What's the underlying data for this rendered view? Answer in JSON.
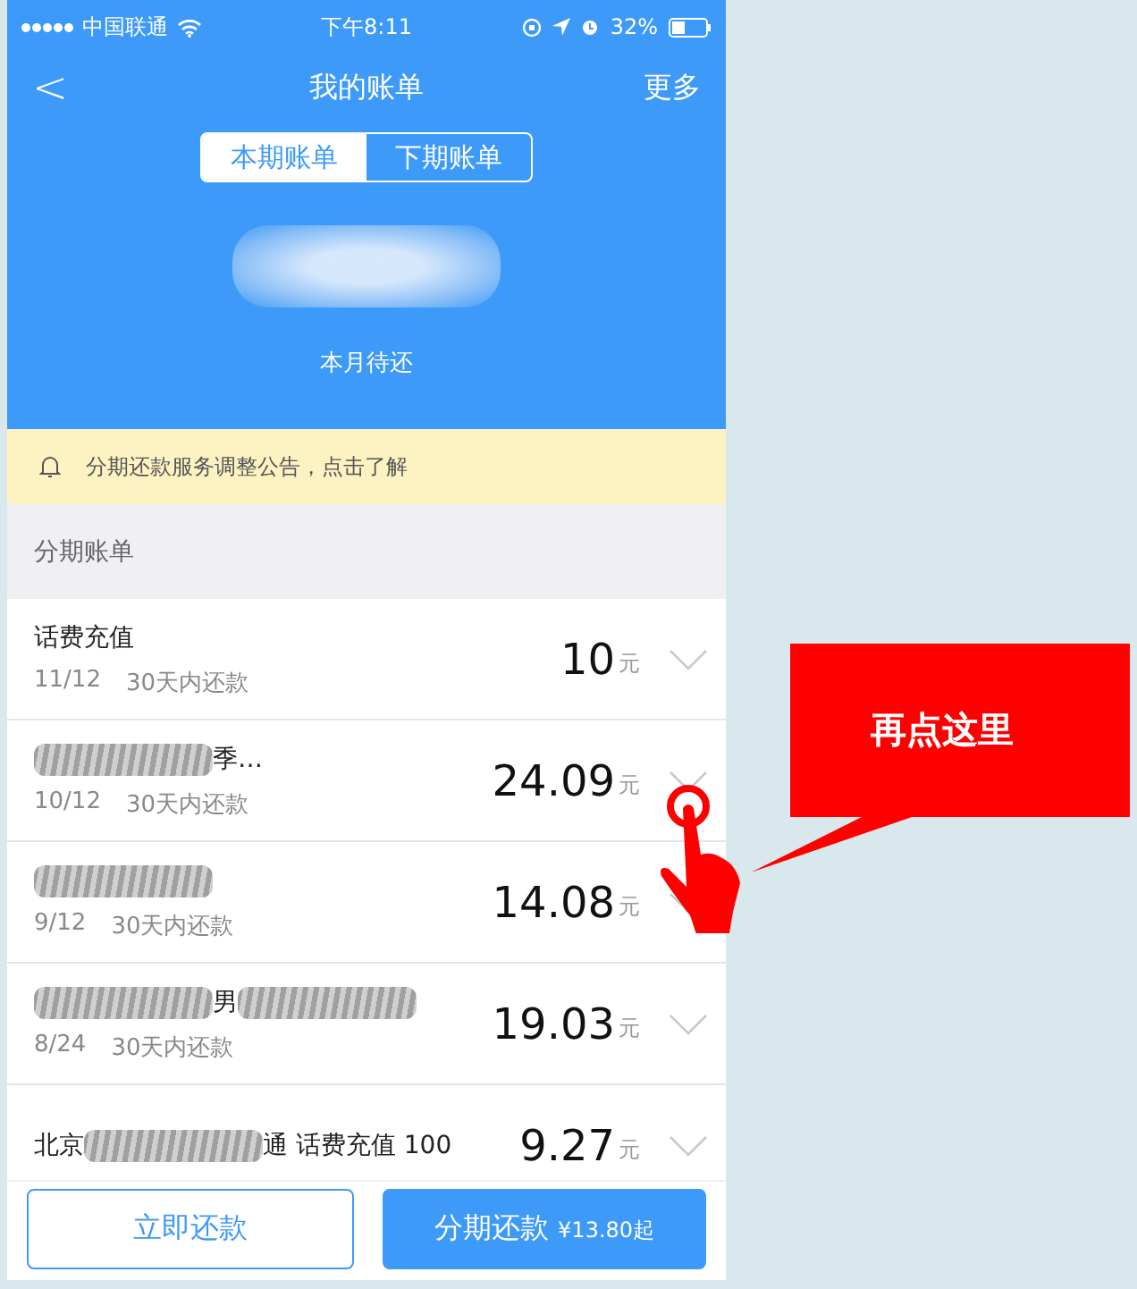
{
  "status_bar": {
    "carrier": "中国联通",
    "time": "下午8:11",
    "battery": "32%"
  },
  "nav": {
    "back": "<",
    "title": "我的账单",
    "more": "更多"
  },
  "tabs": [
    {
      "label": "本期账单",
      "selected": true
    },
    {
      "label": "下期账单",
      "selected": false
    }
  ],
  "summary": {
    "caption": "本月待还"
  },
  "notice": {
    "text": "分期还款服务调整公告，点击了解"
  },
  "section": {
    "title": "分期账单"
  },
  "rows": [
    {
      "title": [
        {
          "kind": "text",
          "text": "话费充值"
        }
      ],
      "date": "11/12",
      "term": "30天内还款",
      "amount": "10",
      "unit": "元"
    },
    {
      "title": [
        {
          "kind": "redacted"
        },
        {
          "kind": "text",
          "text": "季…"
        }
      ],
      "date": "10/12",
      "term": "30天内还款",
      "amount": "24.09",
      "unit": "元"
    },
    {
      "title": [
        {
          "kind": "redacted"
        }
      ],
      "date": "9/12",
      "term": "30天内还款",
      "amount": "14.08",
      "unit": "元"
    },
    {
      "title": [
        {
          "kind": "redacted"
        },
        {
          "kind": "text",
          "text": "男"
        },
        {
          "kind": "redacted"
        }
      ],
      "date": "8/24",
      "term": "30天内还款",
      "amount": "19.03",
      "unit": "元"
    },
    {
      "title": [
        {
          "kind": "text",
          "text": "北京"
        },
        {
          "kind": "redacted"
        },
        {
          "kind": "text",
          "text": "通 话费充值 100"
        }
      ],
      "amount": "9.27",
      "unit": "元"
    }
  ],
  "actions": {
    "pay_now": "立即还款",
    "installment": "分期还款",
    "installment_note": "¥13.80起"
  },
  "callout": {
    "text": "再点这里"
  }
}
